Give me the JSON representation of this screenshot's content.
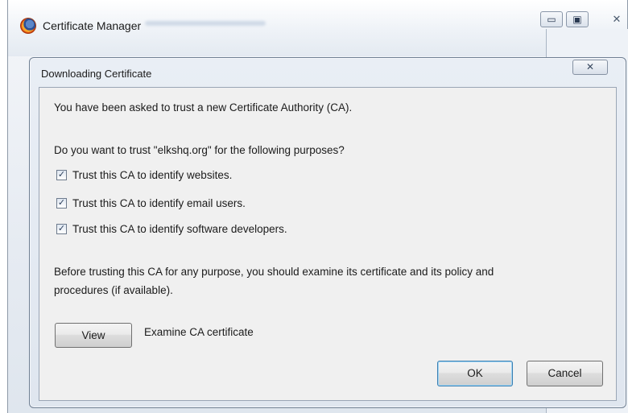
{
  "outer_window": {
    "title": "Certificate Manager",
    "minimize_glyph": "▭",
    "maximize_glyph": "▣",
    "close_glyph": "✕"
  },
  "dialog": {
    "title": "Downloading Certificate",
    "close_glyph": "✕",
    "intro_text": "You have been asked to trust a new Certificate Authority (CA).",
    "question_text": "Do you want to trust \"elkshq.org\" for the following purposes?",
    "checkboxes": [
      {
        "label": "Trust this CA to identify websites.",
        "checked": true
      },
      {
        "label": "Trust this CA to identify email users.",
        "checked": true
      },
      {
        "label": "Trust this CA to identify software developers.",
        "checked": true
      }
    ],
    "warning_line1": "Before trusting this CA for any purpose, you should examine its certificate and its policy and",
    "warning_line2": "procedures (if available).",
    "view_button": "View",
    "view_description": "Examine CA certificate",
    "ok_button": "OK",
    "cancel_button": "Cancel"
  },
  "colors": {
    "ok_border": "#3c7fb1",
    "content_bg": "#f0f0f0"
  }
}
